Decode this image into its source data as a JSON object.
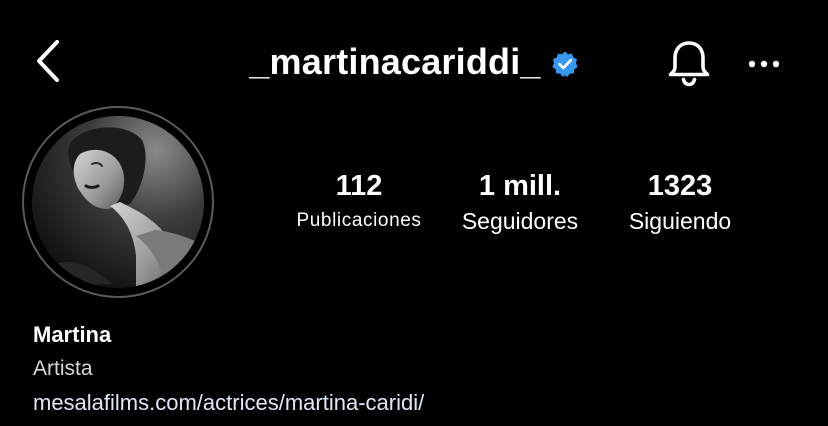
{
  "header": {
    "username": "_martinacariddi_",
    "verified": true,
    "icons": {
      "back": "chevron-left-icon",
      "verified": "verified-badge-icon",
      "notifications": "bell-icon",
      "more": "more-dots-icon"
    }
  },
  "stats": {
    "posts": {
      "value": "112",
      "label": "Publicaciones"
    },
    "followers": {
      "value": "1 mill.",
      "label": "Seguidores"
    },
    "following": {
      "value": "1323",
      "label": "Siguiendo"
    }
  },
  "bio": {
    "name": "Martina",
    "category": "Artista",
    "link": "mesalafilms.com/actrices/martina-caridi/"
  },
  "colors": {
    "background": "#000000",
    "text": "#ffffff",
    "verified_badge": "#3897f0",
    "avatar_ring": "#5a5a5a"
  }
}
